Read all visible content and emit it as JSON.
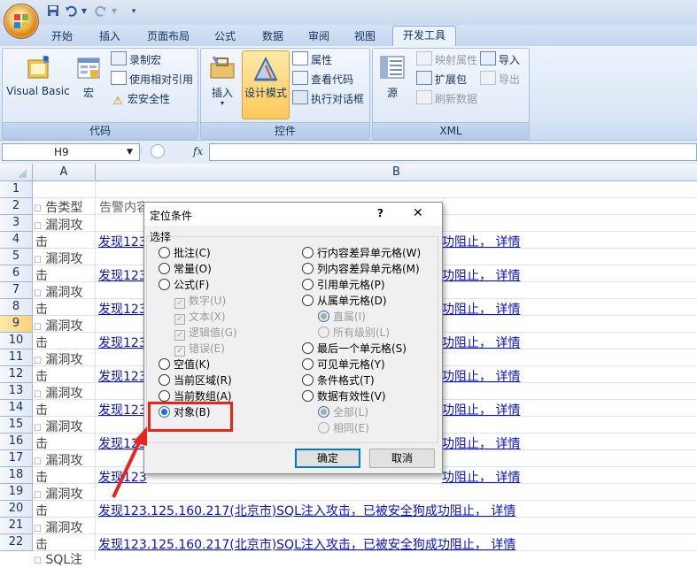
{
  "qat": {
    "save_icon": "save-icon",
    "undo_icon": "undo-icon",
    "redo_icon": "redo-icon",
    "customize_icon": "chevron-down-icon"
  },
  "tabs": [
    "开始",
    "插入",
    "页面布局",
    "公式",
    "数据",
    "审阅",
    "视图",
    "开发工具"
  ],
  "active_tab": "开发工具",
  "ribbon": {
    "code_group": {
      "label": "代码",
      "visual_basic": "Visual Basic",
      "macros": "宏",
      "record_macro": "录制宏",
      "relative_refs": "使用相对引用",
      "macro_security": "宏安全性"
    },
    "controls_group": {
      "label": "控件",
      "insert": "插入",
      "design_mode": "设计模式",
      "properties": "属性",
      "view_code": "查看代码",
      "run_dialog": "执行对话框"
    },
    "xml_group": {
      "label": "XML",
      "source": "源",
      "map_properties": "映射属性",
      "expansion_packs": "扩展包",
      "refresh_data": "刷新数据",
      "import": "导入",
      "export": "导出"
    }
  },
  "formula_bar": {
    "name_box": "H9",
    "fx": "fx",
    "formula": ""
  },
  "columns": [
    "A",
    "B"
  ],
  "rows": [
    "1",
    "2",
    "3",
    "4",
    "5",
    "6",
    "7",
    "8",
    "9",
    "10",
    "11",
    "12",
    "13",
    "14",
    "15",
    "16",
    "17",
    "18",
    "19",
    "20",
    "21",
    "22"
  ],
  "selected_row": "9",
  "sheet": {
    "a2": "告类型",
    "b2": "告警内容",
    "a_vuln": "漏洞攻",
    "a_hit": "击",
    "link_prefix": "发现123",
    "link_tail": "功阻止， 详情",
    "link_full": "发现123.125.160.217(北京市)SQL注入攻击，已被安全狗成功阻止， 详情",
    "row22_a": "SQL注"
  },
  "dialog": {
    "title": "定位条件",
    "help": "?",
    "close": "✕",
    "section": "选择",
    "left_options": [
      {
        "label": "批注(C)",
        "disabled": false,
        "checked": false
      },
      {
        "label": "常量(O)",
        "disabled": false,
        "checked": false
      },
      {
        "label": "公式(F)",
        "disabled": false,
        "checked": false
      },
      {
        "label": "数字(U)",
        "disabled": true,
        "checkbox": true
      },
      {
        "label": "文本(X)",
        "disabled": true,
        "checkbox": true
      },
      {
        "label": "逻辑值(G)",
        "disabled": true,
        "checkbox": true
      },
      {
        "label": "错误(E)",
        "disabled": true,
        "checkbox": true
      },
      {
        "label": "空值(K)",
        "disabled": false,
        "checked": false
      },
      {
        "label": "当前区域(R)",
        "disabled": false,
        "checked": false
      },
      {
        "label": "当前数组(A)",
        "disabled": false,
        "checked": false
      },
      {
        "label": "对象(B)",
        "disabled": false,
        "checked": true
      }
    ],
    "right_options": [
      {
        "label": "行内容差异单元格(W)",
        "disabled": false,
        "checked": false
      },
      {
        "label": "列内容差异单元格(M)",
        "disabled": false,
        "checked": false
      },
      {
        "label": "引用单元格(P)",
        "disabled": false,
        "checked": false
      },
      {
        "label": "从属单元格(D)",
        "disabled": false,
        "checked": false
      },
      {
        "label": "直属(I)",
        "disabled": true,
        "checked": true
      },
      {
        "label": "所有级别(L)",
        "disabled": true,
        "checked": false
      },
      {
        "label": "最后一个单元格(S)",
        "disabled": false,
        "checked": false
      },
      {
        "label": "可见单元格(Y)",
        "disabled": false,
        "checked": false
      },
      {
        "label": "条件格式(T)",
        "disabled": false,
        "checked": false
      },
      {
        "label": "数据有效性(V)",
        "disabled": false,
        "checked": false
      },
      {
        "label": "全部(L)",
        "disabled": true,
        "checked": true
      },
      {
        "label": "相同(E)",
        "disabled": true,
        "checked": false
      }
    ],
    "ok": "确定",
    "cancel": "取消"
  },
  "colors": {
    "annotation_red": "#e8251d",
    "link_blue": "#0b12c4",
    "selected_row_highlight": "#fbd27a"
  }
}
